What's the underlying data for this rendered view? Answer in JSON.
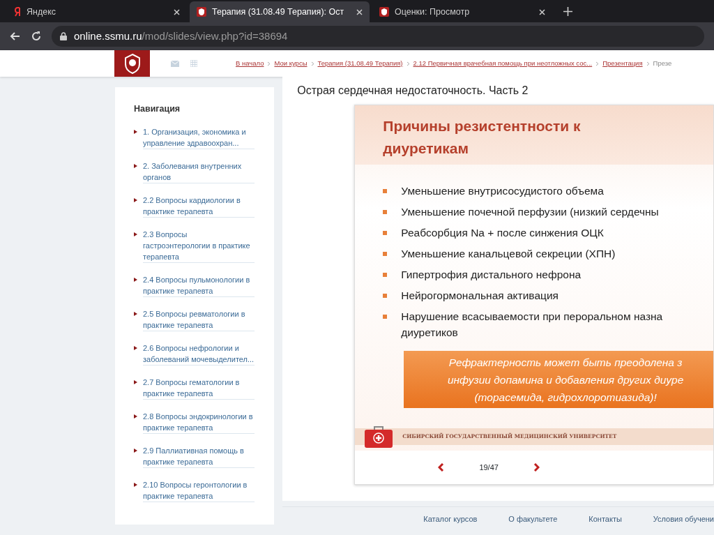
{
  "browser": {
    "tabs": [
      {
        "label": "Яндекс",
        "kind": "yandex",
        "selected": false
      },
      {
        "label": "Терапия (31.08.49 Терапия): Ост",
        "kind": "site",
        "selected": true
      },
      {
        "label": "Оценки: Просмотр",
        "kind": "site",
        "selected": false
      }
    ],
    "url_host": "online.ssmu.ru",
    "url_path": "/mod/slides/view.php?id=38694"
  },
  "breadcrumbs": [
    "В начало",
    "Мои курсы",
    "Терапия (31.08.49 Терапия)",
    "2.12 Первичная врачебная помощь при неотложных сос...",
    "Презентация",
    "Презе"
  ],
  "navigation": {
    "title": "Навигация",
    "items": [
      "1. Организация, экономика и управление здравоохран...",
      "2. Заболевания внутренних органов",
      "2.2 Вопросы кардиологии в практике терапевта",
      "2.3 Вопросы гастроэнтерологии в практике терапевта",
      "2.4 Вопросы пульмонологии в практике терапевта",
      "2.5 Вопросы ревматологии в практике терапевта",
      "2.6 Вопросы нефрологии и заболеваний мочевыделител...",
      "2.7 Вопросы гематологии в практике терапевта",
      "2.8 Вопросы эндокринологии в практике терапевта",
      "2.9 Паллиативная помощь в практике терапевта",
      "2.10 Вопросы геронтологии в практике терапевта"
    ]
  },
  "page_title": "Острая сердечная недостаточность. Часть 2",
  "slide": {
    "title_lines": [
      "Причины резистентности к",
      "диуретикам"
    ],
    "bullets": [
      [
        "Уменьшение внутрисосудистого объема"
      ],
      [
        "Уменьшение почечной перфузии (низкий сердечны"
      ],
      [
        "Реабсорбция Na + после синжения ОЦК"
      ],
      [
        "Уменьшение канальцевой секреции (ХПН)"
      ],
      [
        "Гипертрофия дистального нефрона"
      ],
      [
        "Нейрогормональная активация"
      ],
      [
        "Нарушение всасываемости при пероральном назна",
        "диуретиков"
      ]
    ],
    "callout_lines": [
      "Рефрактерность может быть преодолена з",
      "инфузии допамина и добавления других диуре",
      "(торасемида, гидрохлоротиазида)!"
    ],
    "footer": "СИБИРСКИЙ ГОСУДАРСТВЕННЫЙ МЕДИЦИНСКИЙ УНИВЕРСИТЕТ"
  },
  "pager": "19/47",
  "footer_links": [
    "Каталог курсов",
    "О факультете",
    "Контакты",
    "Условия обучени"
  ]
}
